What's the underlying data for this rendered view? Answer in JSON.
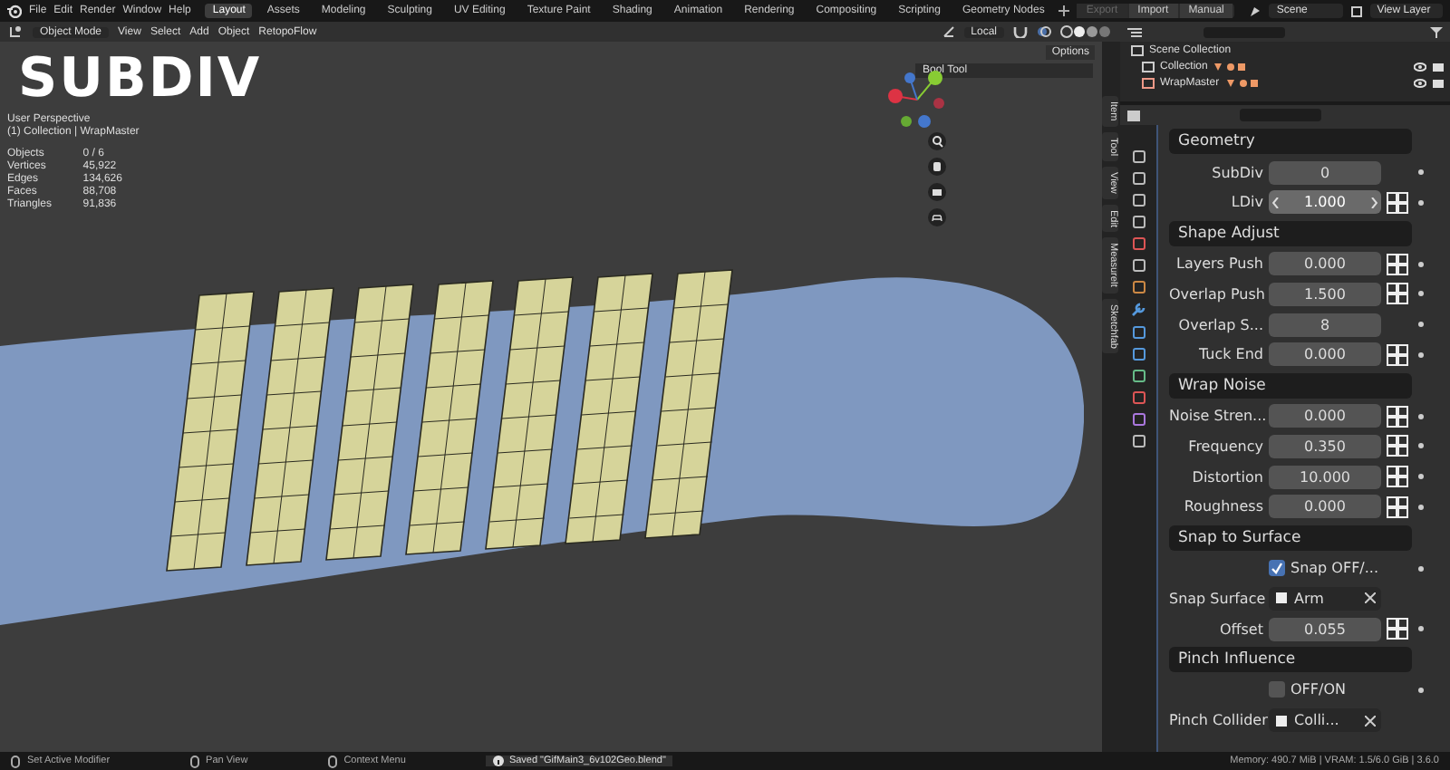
{
  "menu": [
    "File",
    "Edit",
    "Render",
    "Window",
    "Help"
  ],
  "workspaces": [
    {
      "label": "Layout",
      "selected": true
    },
    {
      "label": "Assets",
      "selected": false
    },
    {
      "label": "Modeling",
      "selected": false
    },
    {
      "label": "Sculpting",
      "selected": false
    },
    {
      "label": "UV Editing",
      "selected": false
    },
    {
      "label": "Texture Paint",
      "selected": false
    },
    {
      "label": "Shading",
      "selected": false
    },
    {
      "label": "Animation",
      "selected": false
    },
    {
      "label": "Rendering",
      "selected": false
    },
    {
      "label": "Compositing",
      "selected": false
    },
    {
      "label": "Scripting",
      "selected": false
    },
    {
      "label": "Geometry Nodes",
      "selected": false
    }
  ],
  "top_buttons": [
    {
      "label": "Export",
      "disabled": true
    },
    {
      "label": "Import",
      "disabled": false
    },
    {
      "label": "Manual",
      "disabled": false
    }
  ],
  "scene": "Scene",
  "view_layer": "View Layer",
  "viewport_header": {
    "mode": "Object Mode",
    "menus": [
      "View",
      "Select",
      "Add",
      "Object",
      "RetopoFlow"
    ],
    "orientation": "Local",
    "options": "Options"
  },
  "overlay_title": "SUBDIV",
  "viewport_info": {
    "view": "User Perspective",
    "collection": "(1) Collection | WrapMaster",
    "stats": [
      {
        "label": "Objects",
        "value": "0 / 6"
      },
      {
        "label": "Vertices",
        "value": "45,922"
      },
      {
        "label": "Edges",
        "value": "134,626"
      },
      {
        "label": "Faces",
        "value": "88,708"
      },
      {
        "label": "Triangles",
        "value": "91,836"
      }
    ]
  },
  "side_panel": {
    "panel": "Bool Tool",
    "tabs": [
      "Item",
      "Tool",
      "View",
      "Edit",
      "MeasureIt",
      "Sketchfab"
    ]
  },
  "outliner": {
    "items": [
      {
        "label": "Scene Collection"
      },
      {
        "label": "Collection"
      },
      {
        "label": "WrapMaster"
      }
    ]
  },
  "properties": [
    {
      "kind": "header",
      "label": "Geometry"
    },
    {
      "kind": "int",
      "label": "SubDiv",
      "value": "0"
    },
    {
      "kind": "float",
      "label": "LDiv",
      "value": "1.000",
      "hovered": true
    },
    {
      "kind": "header",
      "label": "Shape Adjust"
    },
    {
      "kind": "float",
      "label": "Layers Push",
      "value": "0.000",
      "hovered": false
    },
    {
      "kind": "float",
      "label": "Overlap Push",
      "value": "1.500",
      "hovered": false
    },
    {
      "kind": "int",
      "label": "Overlap S...",
      "value": "8"
    },
    {
      "kind": "float",
      "label": "Tuck End",
      "value": "0.000",
      "hovered": false
    },
    {
      "kind": "header",
      "label": "Wrap Noise"
    },
    {
      "kind": "float",
      "label": "Noise Stren...",
      "value": "0.000",
      "hovered": false
    },
    {
      "kind": "float",
      "label": "Frequency",
      "value": "0.350",
      "hovered": false
    },
    {
      "kind": "float",
      "label": "Distortion",
      "value": "10.000",
      "hovered": false
    },
    {
      "kind": "float",
      "label": "Roughness",
      "value": "0.000",
      "hovered": false
    },
    {
      "kind": "header",
      "label": "Snap to Surface"
    },
    {
      "kind": "checkbox",
      "label": "Snap OFF/...",
      "checked": true
    },
    {
      "kind": "object",
      "label": "Snap Surface",
      "value": "Arm"
    },
    {
      "kind": "float",
      "label": "Offset",
      "value": "0.055",
      "hovered": false
    },
    {
      "kind": "header",
      "label": "Pinch Influence"
    },
    {
      "kind": "checkbox",
      "label": "OFF/ON",
      "checked": false
    },
    {
      "kind": "object",
      "label": "Pinch Collider",
      "value": "Colli..."
    }
  ],
  "status_bar": {
    "hints": [
      "Set Active Modifier",
      "Pan View",
      "Context Menu"
    ],
    "message": "Saved \"GifMain3_6v102Geo.blend\"",
    "memory": "Memory: 490.7 MiB | VRAM: 1.5/6.0 GiB | 3.6.0"
  }
}
